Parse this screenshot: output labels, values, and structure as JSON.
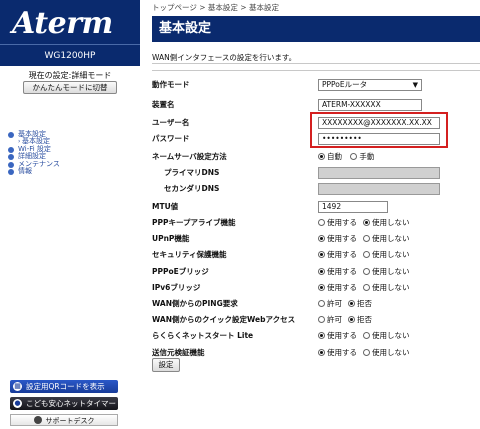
{
  "logo": "Aterm",
  "model": "WG1200HP",
  "mode": {
    "status": "現在の設定:詳細モード",
    "button": "かんたんモードに切替"
  },
  "nav": [
    {
      "label": "基本設定",
      "type": "item"
    },
    {
      "label": "基本設定",
      "type": "sub"
    },
    {
      "label": "Wi-Fi 設定",
      "type": "item"
    },
    {
      "label": "詳細設定",
      "type": "item"
    },
    {
      "label": "メンテナンス",
      "type": "item"
    },
    {
      "label": "情報",
      "type": "item"
    }
  ],
  "sidebar_buttons": {
    "qr": "設定用QRコードを表示",
    "kids": "こども安心ネットタイマー",
    "support": "サポートデスク"
  },
  "breadcrumb": [
    "トップページ",
    "基本設定",
    "基本設定"
  ],
  "breadcrumb_sep": " > ",
  "title": "基本設定",
  "description": "WAN側インタフェースの設定を行います。",
  "form": {
    "mode_label": "動作モード",
    "mode_value": "PPPoEルータ",
    "device_label": "装置名",
    "device_value": "ATERM-XXXXXX",
    "user_label": "ユーザー名",
    "user_value": "XXXXXXXX@XXXXXXX.XX.XX",
    "pass_label": "パスワード",
    "pass_value": "•••••••••",
    "dns_label": "ネームサーバ設定方法",
    "dns_auto": "自動",
    "dns_manual": "手動",
    "primary_label": "プライマリDNS",
    "secondary_label": "セカンダリDNS",
    "mtu_label": "MTU値",
    "mtu_value": "1492"
  },
  "radio_rows": [
    {
      "label": "PPPキープアライブ機能",
      "opt1": "使用する",
      "opt2": "使用しない",
      "selected": 2
    },
    {
      "label": "UPnP機能",
      "opt1": "使用する",
      "opt2": "使用しない",
      "selected": 1
    },
    {
      "label": "セキュリティ保護機能",
      "opt1": "使用する",
      "opt2": "使用しない",
      "selected": 1
    },
    {
      "label": "PPPoEブリッジ",
      "opt1": "使用する",
      "opt2": "使用しない",
      "selected": 1
    },
    {
      "label": "IPv6ブリッジ",
      "opt1": "使用する",
      "opt2": "使用しない",
      "selected": 1
    },
    {
      "label": "WAN側からのPING要求",
      "opt1": "許可",
      "opt2": "拒否",
      "selected": 2
    },
    {
      "label": "WAN側からのクイック設定Webアクセス",
      "opt1": "許可",
      "opt2": "拒否",
      "selected": 2
    },
    {
      "label": "らくらくネットスタート Lite",
      "opt1": "使用する",
      "opt2": "使用しない",
      "selected": 1
    },
    {
      "label": "送信元検証機能",
      "opt1": "使用する",
      "opt2": "使用しない",
      "selected": 1
    }
  ],
  "submit": "設定",
  "colors": {
    "header": "#0a2a6e",
    "highlight": "#d42020",
    "nav": "#2a4ea0"
  }
}
